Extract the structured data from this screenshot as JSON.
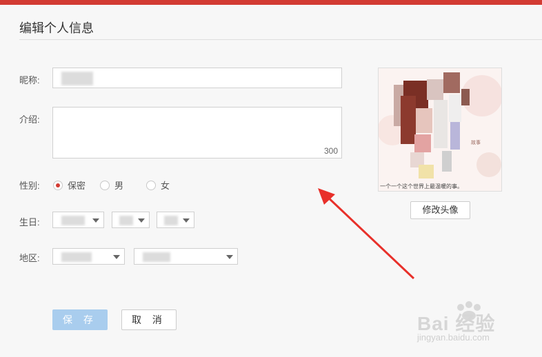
{
  "page": {
    "title": "编辑个人信息",
    "accent": "#d33b33"
  },
  "form": {
    "nickname": {
      "label": "昵称:"
    },
    "intro": {
      "label": "介绍:",
      "counter": "300"
    },
    "gender": {
      "label": "性别:",
      "options": [
        {
          "label": "保密",
          "selected": true
        },
        {
          "label": "男",
          "selected": false
        },
        {
          "label": "女",
          "selected": false
        }
      ]
    },
    "birthday": {
      "label": "生日:"
    },
    "region": {
      "label": "地区:"
    }
  },
  "avatar": {
    "change_label": "修改头像",
    "caption": "一个一个这个世界上最温暖的事。"
  },
  "actions": {
    "save_label": "保 存",
    "cancel_label": "取 消"
  },
  "watermark": {
    "brand": "Bai 经验",
    "url": "jingyan.baidu.com"
  },
  "colors": {
    "save_button": "#a9cdee",
    "annotation_arrow": "#e8302a",
    "radio_selected": "#d33b33"
  }
}
